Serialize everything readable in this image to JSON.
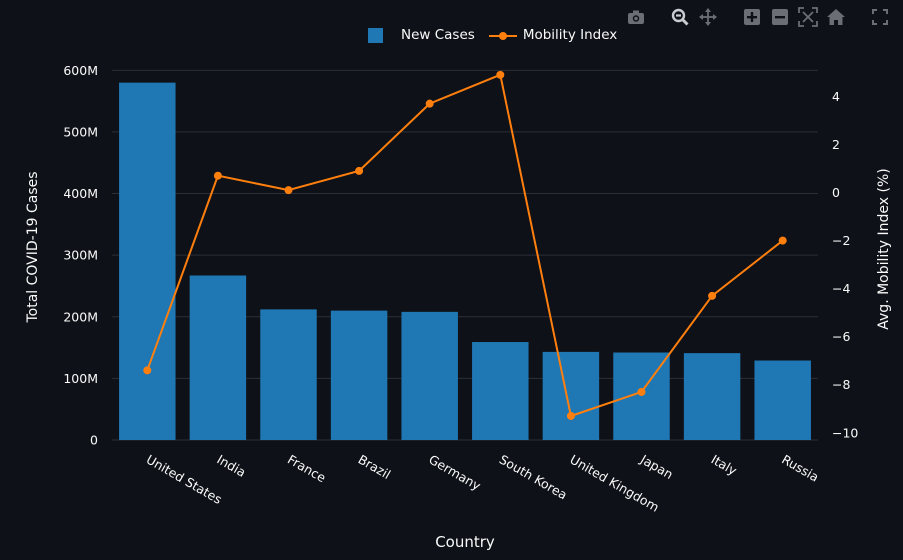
{
  "chart_data": {
    "type": "bar",
    "categories": [
      "United States",
      "India",
      "France",
      "Brazil",
      "Germany",
      "South Korea",
      "United Kingdom",
      "Japan",
      "Italy",
      "Russia"
    ],
    "series": [
      {
        "name": "New Cases",
        "type": "bar",
        "axis": "y",
        "color": "#1f77b4",
        "values": [
          580000000,
          267000000,
          212000000,
          210000000,
          208000000,
          159000000,
          143000000,
          142000000,
          141000000,
          129000000
        ]
      },
      {
        "name": "Mobility Index",
        "type": "line",
        "axis": "y2",
        "color": "#ff7f0e",
        "values": [
          -7.4,
          0.7,
          0.1,
          0.9,
          3.7,
          4.9,
          -9.3,
          -8.3,
          -4.3,
          -2.0
        ]
      }
    ],
    "xlabel": "Country",
    "ylabel": "Total COVID-19 Cases",
    "y2label": "Avg. Mobility Index (%)",
    "ylim": [
      0,
      620000000
    ],
    "y2lim": [
      -10.3,
      5.6
    ],
    "yticks": [
      0,
      100000000,
      200000000,
      300000000,
      400000000,
      500000000,
      600000000
    ],
    "yticklabels": [
      "0",
      "100M",
      "200M",
      "300M",
      "400M",
      "500M",
      "600M"
    ],
    "y2ticks": [
      -10,
      -8,
      -6,
      -4,
      -2,
      0,
      2,
      4
    ],
    "y2ticklabels": [
      "−10",
      "−8",
      "−6",
      "−4",
      "−2",
      "0",
      "2",
      "4"
    ],
    "grid": true,
    "legend": "top-center",
    "background": "#0e1117",
    "gridcolor": "#2b2f38"
  },
  "toolbar": {
    "icons": [
      "camera-icon",
      "zoom-icon",
      "pan-icon",
      "zoom-in-icon",
      "zoom-out-icon",
      "autoscale-icon",
      "home-icon",
      "fullscreen-icon"
    ]
  }
}
